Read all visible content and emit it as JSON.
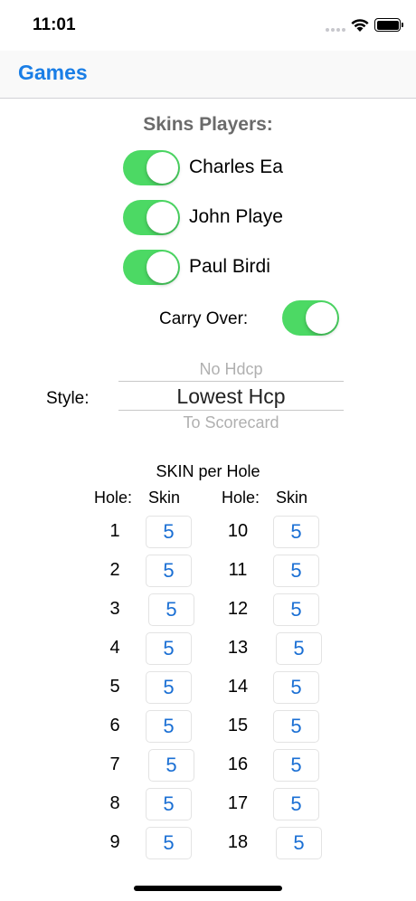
{
  "status_bar": {
    "time": "11:01"
  },
  "nav": {
    "back_label": "Games"
  },
  "skins": {
    "title": "Skins Players:",
    "players": [
      {
        "name": "Charles Ea",
        "enabled": true
      },
      {
        "name": "John Playe",
        "enabled": true
      },
      {
        "name": "Paul Birdi",
        "enabled": true
      }
    ]
  },
  "carry_over": {
    "label": "Carry Over:",
    "enabled": true
  },
  "style": {
    "label": "Style:",
    "options_visible": [
      "No Hdcp",
      "Lowest Hcp",
      "To Scorecard"
    ],
    "selected": "Lowest Hcp"
  },
  "skin_table": {
    "title": "SKIN per Hole",
    "hole_header": "Hole:",
    "skin_header": "Skin",
    "holes": [
      {
        "hole": "1",
        "skin": "5"
      },
      {
        "hole": "2",
        "skin": "5"
      },
      {
        "hole": "3",
        "skin": "5"
      },
      {
        "hole": "4",
        "skin": "5"
      },
      {
        "hole": "5",
        "skin": "5"
      },
      {
        "hole": "6",
        "skin": "5"
      },
      {
        "hole": "7",
        "skin": "5"
      },
      {
        "hole": "8",
        "skin": "5"
      },
      {
        "hole": "9",
        "skin": "5"
      },
      {
        "hole": "10",
        "skin": "5"
      },
      {
        "hole": "11",
        "skin": "5"
      },
      {
        "hole": "12",
        "skin": "5"
      },
      {
        "hole": "13",
        "skin": "5"
      },
      {
        "hole": "14",
        "skin": "5"
      },
      {
        "hole": "15",
        "skin": "5"
      },
      {
        "hole": "16",
        "skin": "5"
      },
      {
        "hole": "17",
        "skin": "5"
      },
      {
        "hole": "18",
        "skin": "5"
      }
    ]
  },
  "colors": {
    "accent": "#1a7ee6",
    "toggle_on": "#4cd964",
    "skin_value": "#1a6fd4"
  }
}
